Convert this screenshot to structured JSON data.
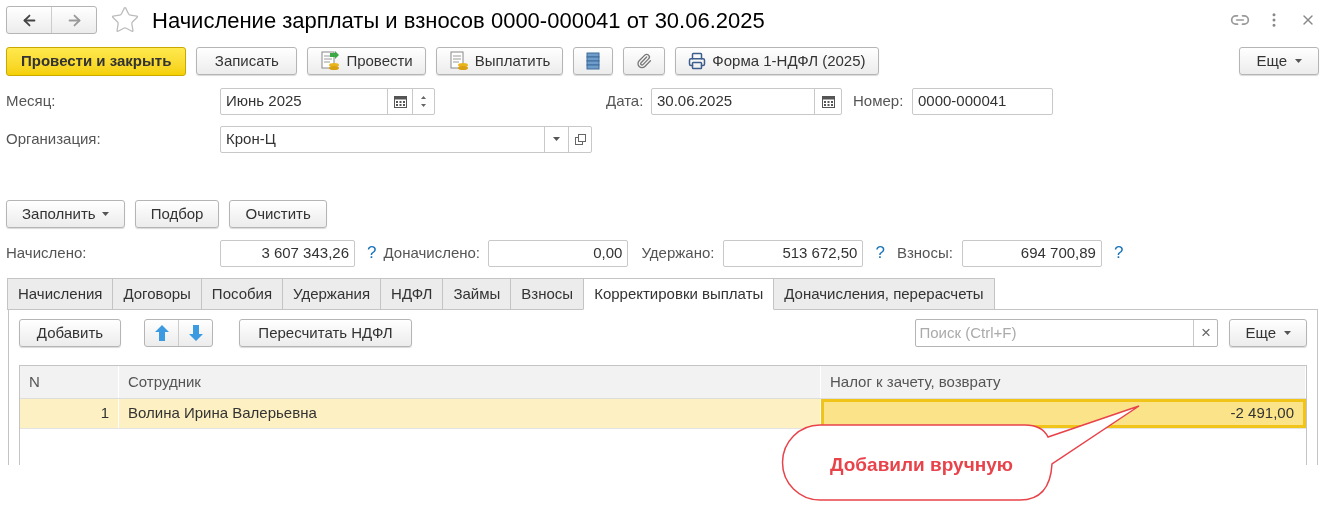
{
  "window": {
    "title": "Начисление зарплаты и взносов 0000-000041 от 30.06.2025"
  },
  "toolbar": {
    "buttons": [
      {
        "kind": "primary",
        "label": "Провести и закрыть"
      },
      {
        "kind": "plain",
        "label": "Записать"
      },
      {
        "kind": "post",
        "label": "Провести"
      },
      {
        "kind": "pay",
        "label": "Выплатить"
      },
      {
        "kind": "list"
      },
      {
        "kind": "attach"
      },
      {
        "kind": "print",
        "label": "Форма 1-НДФЛ (2025)"
      }
    ],
    "more": "Еще"
  },
  "fields": {
    "month": {
      "label": "Месяц:",
      "value": "Июнь 2025"
    },
    "date": {
      "label": "Дата:",
      "value": "30.06.2025"
    },
    "number": {
      "label": "Номер:",
      "value": "0000-000041"
    },
    "organization": {
      "label": "Организация:",
      "value": "Крон-Ц"
    }
  },
  "fill_buttons": [
    {
      "label": "Заполнить",
      "dropdown": true
    },
    {
      "label": "Подбор",
      "dropdown": false
    },
    {
      "label": "Очистить",
      "dropdown": false
    }
  ],
  "totals": [
    {
      "label": "Начислено:",
      "value": "3 607 343,26",
      "help": "?"
    },
    {
      "label": "Доначислено:",
      "value": "0,00"
    },
    {
      "label": "Удержано:",
      "value": "513 672,50",
      "help": "?"
    },
    {
      "label": "Взносы:",
      "value": "694 700,89",
      "help": "?"
    }
  ],
  "tabs": [
    {
      "label": "Начисления",
      "selected": false
    },
    {
      "label": "Договоры",
      "selected": false
    },
    {
      "label": "Пособия",
      "selected": false
    },
    {
      "label": "Удержания",
      "selected": false
    },
    {
      "label": "НДФЛ",
      "selected": false
    },
    {
      "label": "Займы",
      "selected": false
    },
    {
      "label": "Взносы",
      "selected": false
    },
    {
      "label": "Корректировки выплаты",
      "selected": true
    },
    {
      "label": "Доначисления, перерасчеты",
      "selected": false
    }
  ],
  "panel": {
    "add": "Добавить",
    "recalc": "Пересчитать НДФЛ",
    "search": {
      "placeholder": "Поиск (Ctrl+F)",
      "clear": "×"
    },
    "more": "Еще"
  },
  "table": {
    "columns": [
      "N",
      "Сотрудник",
      "Налог к зачету, возврату"
    ],
    "rows": [
      {
        "selected": true,
        "cells": [
          {
            "text": "1",
            "selected": false
          },
          {
            "text": "Волина Ирина Валерьевна",
            "selected": false
          },
          {
            "text": "-2 491,00",
            "selected": true
          }
        ]
      }
    ]
  },
  "callout": {
    "text": "Добавили вручную"
  }
}
